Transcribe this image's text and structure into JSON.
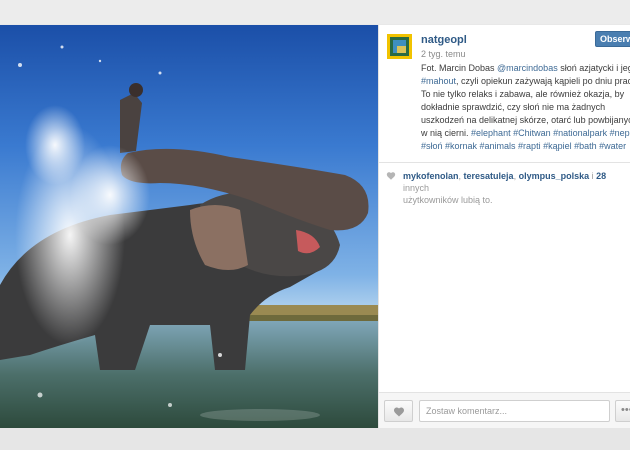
{
  "post": {
    "username": "natgeopl",
    "follow_label": "Obserwuj",
    "timestamp": "2 tyg. temu",
    "caption": {
      "line1": {
        "pre": "Fot. Marcin Dobas ",
        "mention": "@marcindobas",
        "post": " słoń azjatycki i jego"
      },
      "line2": {
        "tag": "#mahout",
        "post": ", czyli opiekun zażywają kąpieli po dniu pracy."
      },
      "line3": "To nie tylko relaks i zabawa, ale również okazja, by",
      "line4": "dokładnie sprawdzić, czy słoń nie ma żadnych",
      "line5": "uszkodzeń na delikatnej skórze, otarć lub powbijanych",
      "line6": {
        "pre": "w nią cierni. ",
        "tags": "#elephant #Chitwan #nationalpark #nepal"
      },
      "line7": {
        "tags": "#słoń #kornak #animals #rapti #kąpiel #bath #water"
      }
    },
    "likes": {
      "users": [
        "mykofenolan",
        "teresatuleja",
        "olympus_polska"
      ],
      "separator": ", ",
      "connector": " i ",
      "count": "28",
      "suffix": " innych",
      "line2": "użytkowników lubią to."
    },
    "comment_placeholder": "Zostaw komentarz...",
    "more_label": "•••"
  },
  "icons": {
    "heart": "heart-icon",
    "like": "heart-icon"
  },
  "colors": {
    "link": "#2f5a86",
    "follow_button": "#4a7eb0",
    "avatar_border": "#f1c300"
  }
}
